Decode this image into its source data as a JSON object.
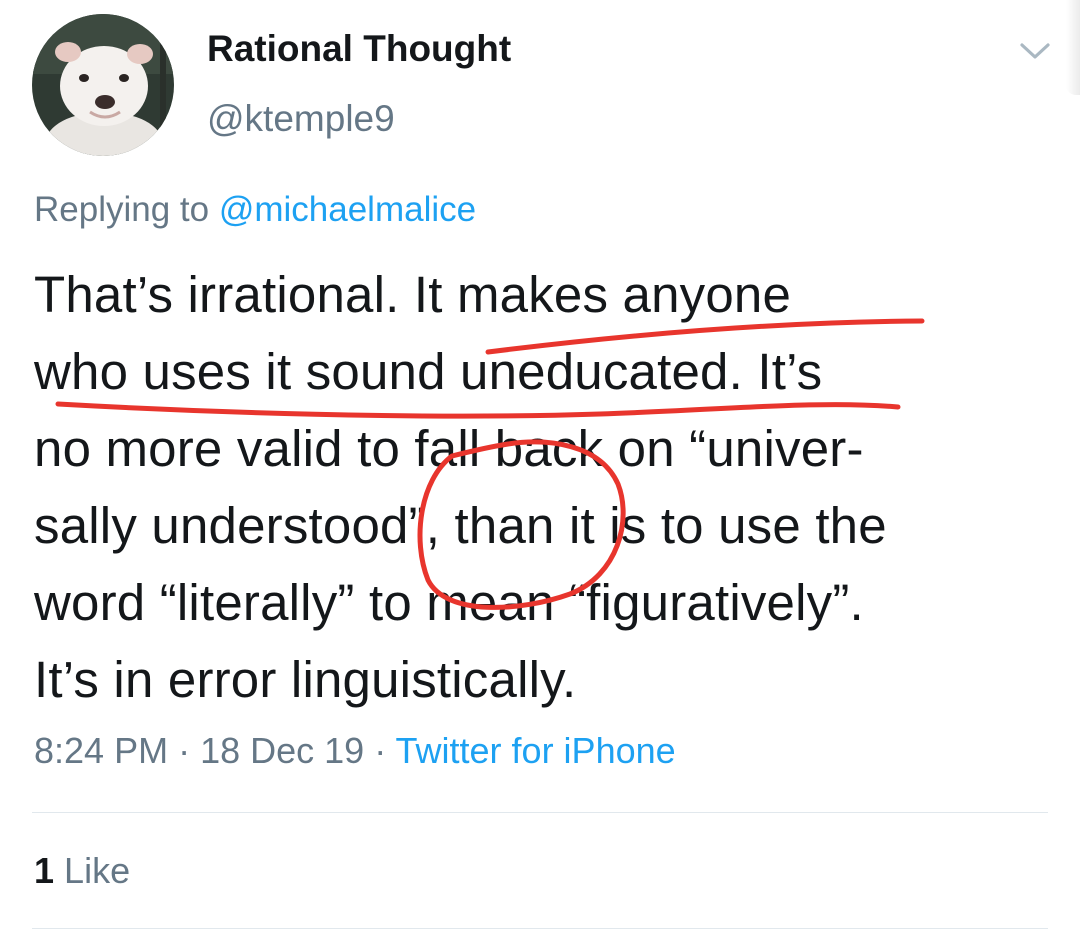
{
  "author": {
    "display_name": "Rational Thought",
    "handle": "@ktemple9",
    "avatar_icon": "bulldog-avatar"
  },
  "menu": {
    "icon": "chevron-down-icon"
  },
  "reply": {
    "prefix": "Replying to ",
    "mention": "@michaelmalice"
  },
  "tweet": {
    "lines": [
      "That’s irrational.  It makes anyone",
      "who uses it sound uneducated.  It’s",
      "no more valid to fall back on “univer-",
      "sally understood”, than it is to use the",
      "word “literally” to mean “figuratively”.",
      "It’s in error linguistically."
    ]
  },
  "meta": {
    "time": "8:24 PM",
    "separator": " · ",
    "date": "18 Dec 19",
    "source": "Twitter for iPhone"
  },
  "engagement": {
    "like_count": "1",
    "like_label": "Like"
  },
  "colors": {
    "text": "#14171a",
    "secondary": "#657786",
    "link": "#1da1f2",
    "annotation": "#e8352d",
    "divider": "#e1e8ed"
  }
}
